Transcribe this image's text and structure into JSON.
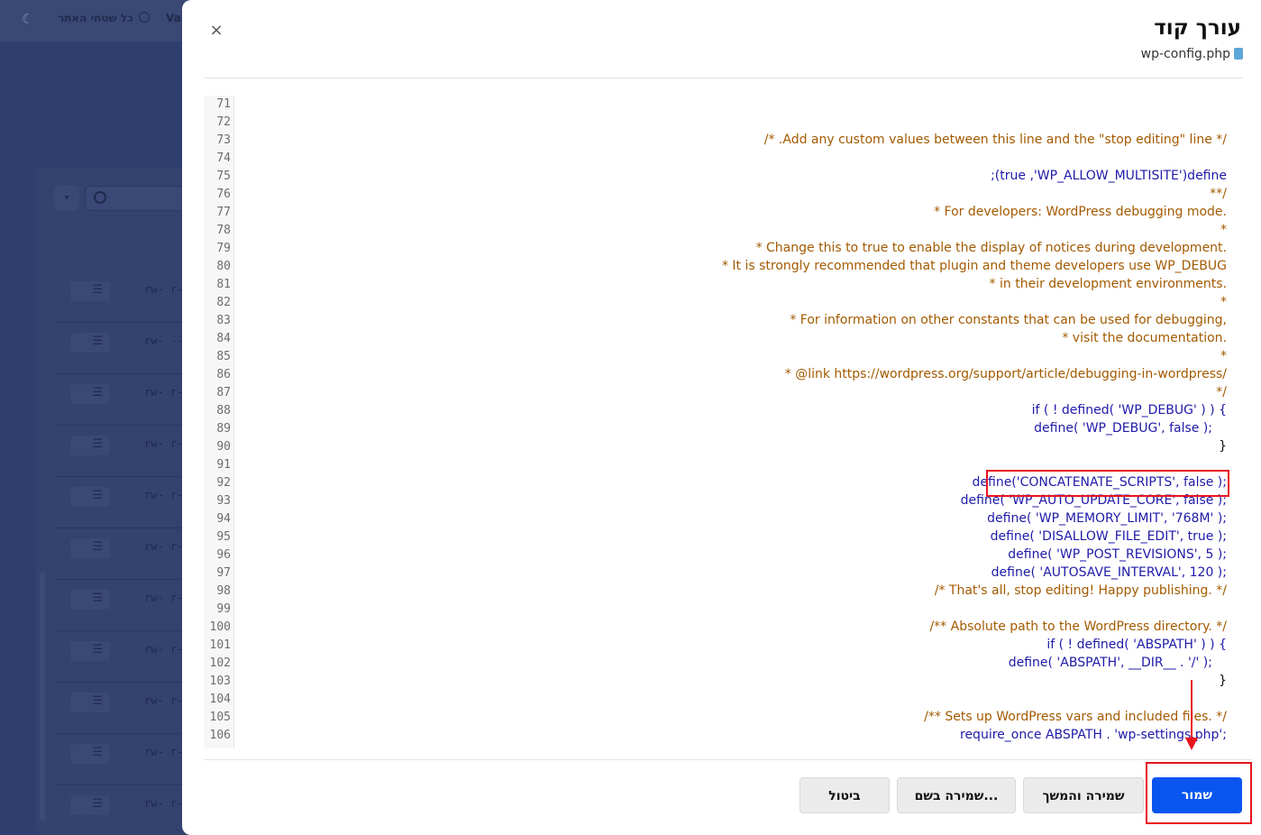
{
  "background": {
    "all_sites_label": "כל שטחי האתר",
    "var_label": "Var",
    "rows": [
      {
        "perm": "rw- r--"
      },
      {
        "perm": "rw- ---"
      },
      {
        "perm": "rw- r--"
      },
      {
        "perm": "rw- r--"
      },
      {
        "perm": "rw- r--"
      },
      {
        "perm": "rw- r--"
      },
      {
        "perm": "rw- r--"
      },
      {
        "perm": "rw- r--"
      },
      {
        "perm": "rw- r--"
      },
      {
        "perm": "rw- r--"
      },
      {
        "perm": "rw- r--"
      }
    ]
  },
  "modal": {
    "title": "עורך קוד",
    "file_name": "wp-config.php",
    "close_symbol": "×",
    "line_numbers": [
      "71",
      "72",
      "73",
      "74",
      "75",
      "76",
      "77",
      "78",
      "79",
      "80",
      "81",
      "82",
      "83",
      "84",
      "85",
      "86",
      "87",
      "88",
      "89",
      "90",
      "91",
      "92",
      "93",
      "94",
      "95",
      "96",
      "97",
      "98",
      "99",
      "100",
      "101",
      "102",
      "103",
      "104",
      "105",
      "106"
    ],
    "code_lines": [
      "",
      "",
      "/* .Add any custom values between this line and the \"stop editing\" line */",
      "",
      ";(true ,'WP_ALLOW_MULTISITE')define",
      "**/",
      "* For developers: WordPress debugging mode.",
      "*",
      "* Change this to true to enable the display of notices during development.",
      "* It is strongly recommended that plugin and theme developers use WP_DEBUG",
      "* in their development environments.",
      "*",
      "* For information on other constants that can be used for debugging,",
      "* visit the documentation.",
      "*",
      "* @link https://wordpress.org/support/article/debugging-in-wordpress/",
      "*/",
      "if ( ! defined( 'WP_DEBUG' ) ) {",
      "define( 'WP_DEBUG', false );",
      "}",
      "",
      "define('CONCATENATE_SCRIPTS', false );",
      "define( 'WP_AUTO_UPDATE_CORE', false );",
      "define( 'WP_MEMORY_LIMIT', '768M' );",
      "define( 'DISALLOW_FILE_EDIT', true );",
      "define( 'WP_POST_REVISIONS', 5 );",
      "define( 'AUTOSAVE_INTERVAL', 120 );",
      "/* That's all, stop editing! Happy publishing. */",
      "",
      "/** Absolute path to the WordPress directory. */",
      "if ( ! defined( 'ABSPATH' ) ) {",
      "define( 'ABSPATH', __DIR__ . '/' );",
      "}",
      "",
      "/** Sets up WordPress vars and included files. */",
      "require_once ABSPATH . 'wp-settings.php';"
    ],
    "buttons": {
      "save": "שמור",
      "save_continue": "שמירה והמשך",
      "save_as": "שמירה בשם...",
      "cancel": "ביטול"
    },
    "annotation_color": "#e8141d",
    "primary_color": "#0a55f0"
  }
}
